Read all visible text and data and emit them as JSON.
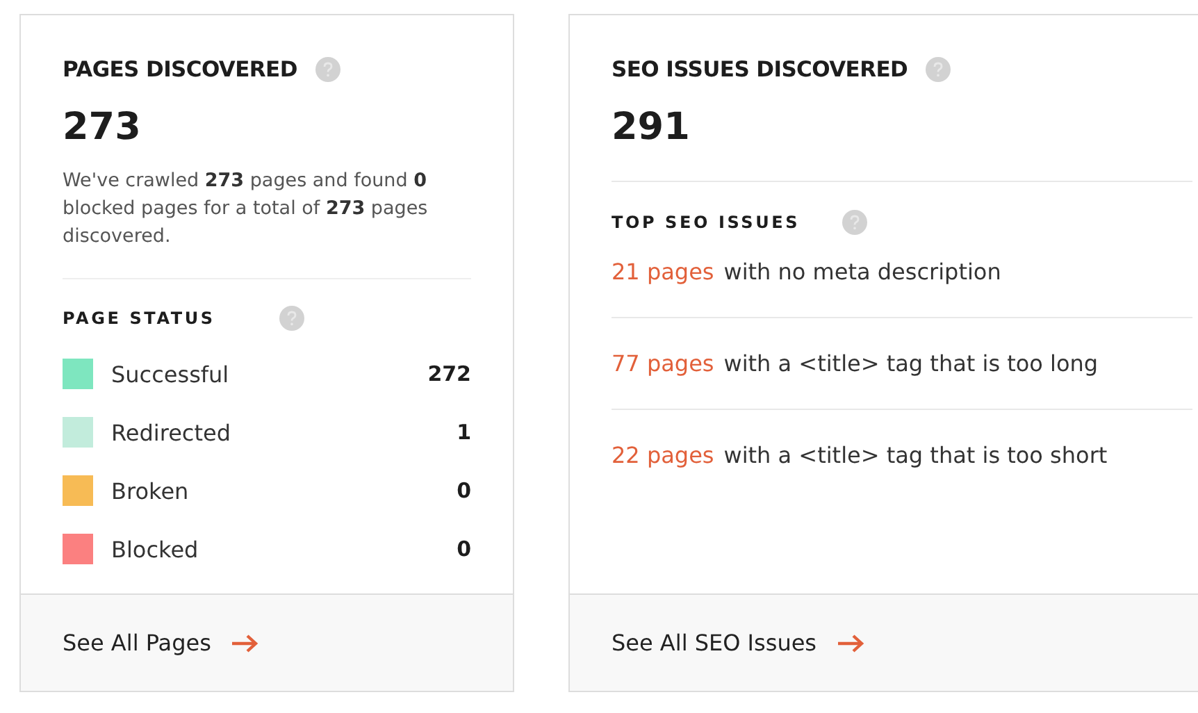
{
  "pages_card": {
    "title": "PAGES DISCOVERED",
    "total": "273",
    "summary": "We've crawled **273** pages and found **0** blocked pages for a total of **273** pages discovered.",
    "status_heading": "PAGE STATUS",
    "statuses": [
      {
        "label": "Successful",
        "count": "272",
        "color": "#7ee6bf"
      },
      {
        "label": "Redirected",
        "count": "1",
        "color": "#c2ecdc"
      },
      {
        "label": "Broken",
        "count": "0",
        "color": "#f7bb55"
      },
      {
        "label": "Blocked",
        "count": "0",
        "color": "#fb8080"
      }
    ],
    "footer_link": "See All Pages"
  },
  "seo_card": {
    "title": "SEO ISSUES DISCOVERED",
    "total": "291",
    "issues_heading": "TOP SEO ISSUES",
    "issues": [
      {
        "count": "21 pages",
        "description": "with no meta description"
      },
      {
        "count": "77 pages",
        "description": "with a <title> tag that is too long"
      },
      {
        "count": "22 pages",
        "description": "with a <title> tag that is too short"
      }
    ],
    "footer_link": "See All SEO Issues"
  }
}
